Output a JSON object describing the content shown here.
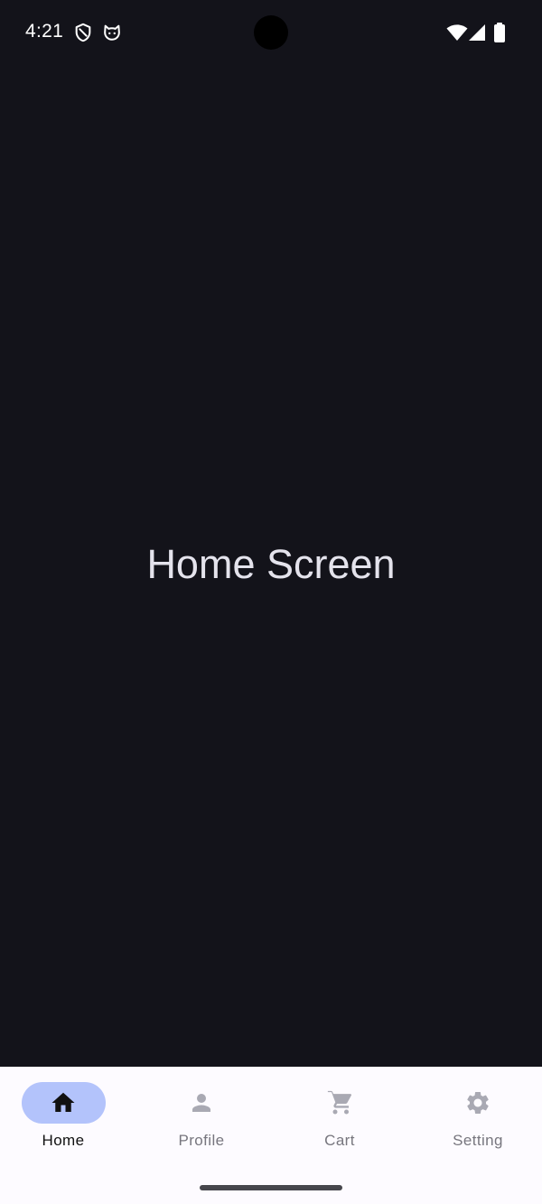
{
  "status_bar": {
    "time": "4:21",
    "left_icons": [
      "shield-icon",
      "cat-icon"
    ],
    "right_icons": [
      "wifi-icon",
      "cellular-signal-icon",
      "battery-icon"
    ]
  },
  "main": {
    "title": "Home Screen"
  },
  "bottom_nav": {
    "items": [
      {
        "label": "Home",
        "icon": "home-icon",
        "active": true
      },
      {
        "label": "Profile",
        "icon": "person-icon",
        "active": false
      },
      {
        "label": "Cart",
        "icon": "shopping-cart-icon",
        "active": false
      },
      {
        "label": "Setting",
        "icon": "gear-icon",
        "active": false
      }
    ]
  },
  "colors": {
    "background": "#13131a",
    "title_text": "#e4e3ec",
    "nav_background": "#fdfbff",
    "active_pill": "#b3c3fb",
    "inactive_icon": "#a9a9b3",
    "inactive_label": "#77767e"
  }
}
